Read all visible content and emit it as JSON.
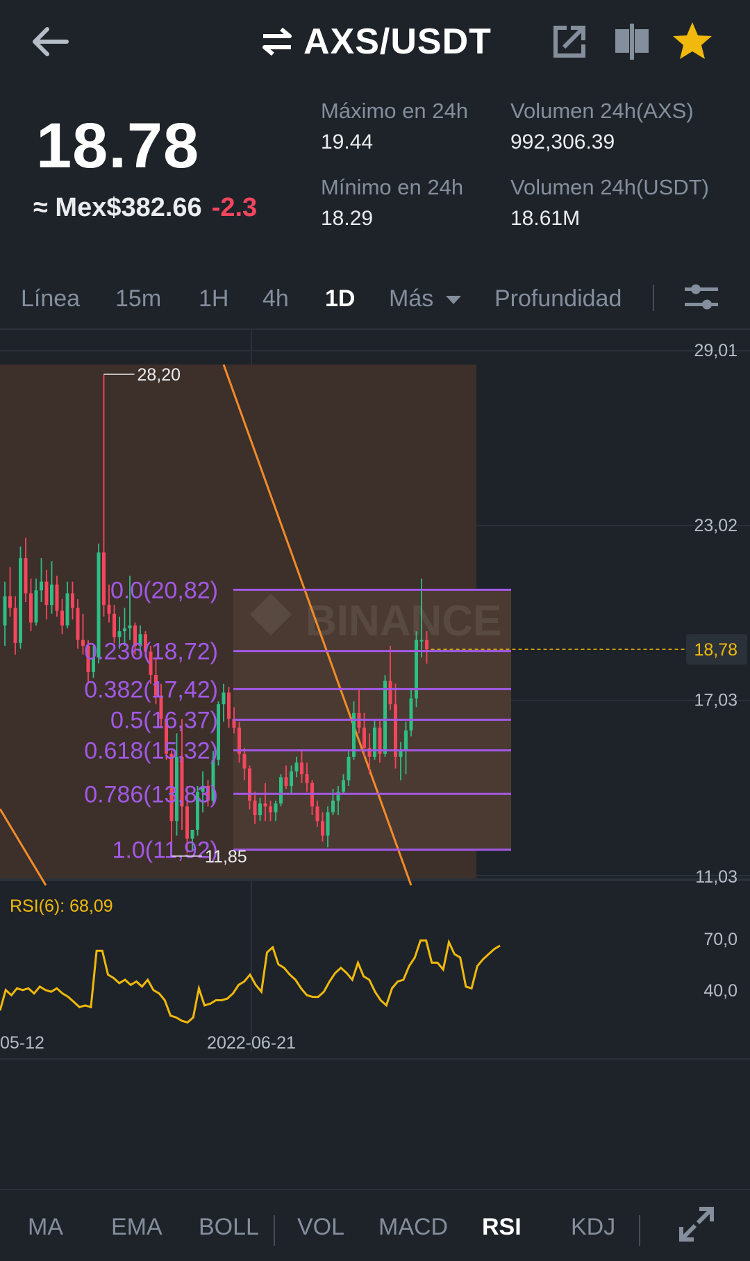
{
  "header": {
    "title": "AXS/USDT",
    "back_icon": "arrow-left-icon",
    "swap_icon": "swap-arrows-icon",
    "share_icon": "share-external-icon",
    "compare_icon": "candlestick-compare-icon",
    "favorite_icon": "star-icon",
    "favorite_color": "#f0b90b"
  },
  "ticker": {
    "last_price": "18.78",
    "fiat_price": "≈ Mex$382.66",
    "change": "-2.3",
    "high_label": "Máximo en 24h",
    "high_value": "19.44",
    "low_label": "Mínimo en 24h",
    "low_value": "18.29",
    "vol_base_label": "Volumen 24h(AXS)",
    "vol_base_value": "992,306.39",
    "vol_quote_label": "Volumen 24h(USDT)",
    "vol_quote_value": "18.61M"
  },
  "timeframes": [
    "Línea",
    "15m",
    "1H",
    "4h",
    "1D",
    "Más",
    "Profundidad"
  ],
  "active_timeframe": "1D",
  "indicators": [
    "MA",
    "EMA",
    "BOLL",
    "VOL",
    "MACD",
    "RSI",
    "KDJ"
  ],
  "active_indicator": "RSI",
  "colors": {
    "up": "#2ebd85",
    "down": "#f6465d",
    "fib": "#a259e6",
    "trend": "#f28c28",
    "rsi": "#f0b90b",
    "current_price": "#f0b90b"
  },
  "chart_data": {
    "type": "candlestick",
    "price_axis_ticks": [
      "29,01",
      "23,02",
      "17,03",
      "11,03"
    ],
    "price_range": [
      11.03,
      29.01
    ],
    "current_price_label": "18,78",
    "high_marker": "28,20",
    "low_marker": "11,85",
    "watermark": "BINANCE",
    "fibonacci": [
      {
        "level": "0.0",
        "price": 20.82,
        "label": "0.0(20,82)"
      },
      {
        "level": "0.236",
        "price": 18.72,
        "label": "0.236(18,72)"
      },
      {
        "level": "0.382",
        "price": 17.42,
        "label": "0.382(17,42)"
      },
      {
        "level": "0.5",
        "price": 16.37,
        "label": "0.5(16,37)"
      },
      {
        "level": "0.618",
        "price": 15.32,
        "label": "0.618(15,32)"
      },
      {
        "level": "0.786",
        "price": 13.83,
        "label": "0.786(13,83)"
      },
      {
        "level": "1.0",
        "price": 11.92,
        "label": "1.0(11,92)"
      }
    ],
    "candles": [
      [
        19.6,
        21.1,
        18.9,
        20.6
      ],
      [
        20.6,
        21.6,
        19.9,
        20.2
      ],
      [
        20.2,
        20.6,
        18.6,
        19.0
      ],
      [
        19.0,
        22.3,
        18.8,
        21.9
      ],
      [
        21.9,
        22.6,
        20.4,
        20.7
      ],
      [
        20.7,
        21.2,
        19.4,
        19.7
      ],
      [
        19.7,
        21.2,
        19.6,
        20.8
      ],
      [
        20.8,
        21.9,
        20.4,
        21.1
      ],
      [
        21.1,
        21.5,
        19.8,
        20.3
      ],
      [
        20.3,
        21.8,
        20.0,
        21.0
      ],
      [
        21.0,
        21.3,
        19.9,
        20.1
      ],
      [
        20.1,
        20.5,
        19.3,
        19.6
      ],
      [
        19.6,
        21.1,
        19.5,
        20.7
      ],
      [
        20.7,
        21.1,
        19.8,
        20.2
      ],
      [
        20.2,
        20.5,
        18.8,
        19.1
      ],
      [
        19.1,
        20.0,
        18.6,
        18.9
      ],
      [
        18.9,
        19.1,
        17.6,
        18.0
      ],
      [
        18.0,
        18.9,
        17.8,
        18.5
      ],
      [
        18.5,
        22.4,
        18.3,
        22.1
      ],
      [
        22.1,
        28.2,
        19.9,
        20.3
      ],
      [
        20.3,
        21.0,
        19.7,
        20.0
      ],
      [
        20.0,
        20.3,
        19.0,
        19.2
      ],
      [
        19.2,
        19.9,
        18.8,
        19.4
      ],
      [
        19.4,
        20.2,
        18.9,
        19.5
      ],
      [
        19.5,
        21.3,
        19.1,
        19.6
      ],
      [
        19.6,
        19.7,
        18.6,
        18.9
      ],
      [
        18.9,
        19.6,
        18.6,
        19.3
      ],
      [
        19.3,
        19.4,
        18.5,
        18.7
      ],
      [
        18.7,
        18.9,
        17.6,
        17.9
      ],
      [
        17.9,
        18.5,
        16.9,
        17.2
      ],
      [
        17.2,
        17.6,
        16.1,
        16.4
      ],
      [
        16.4,
        16.5,
        15.0,
        15.2
      ],
      [
        15.2,
        15.3,
        11.7,
        12.9
      ],
      [
        12.9,
        15.9,
        12.4,
        15.1
      ],
      [
        15.1,
        16.4,
        12.6,
        13.4
      ],
      [
        13.4,
        14.1,
        11.8,
        12.3
      ],
      [
        12.3,
        12.5,
        11.85,
        12.6
      ],
      [
        12.6,
        14.1,
        12.4,
        13.9
      ],
      [
        13.9,
        14.6,
        13.2,
        14.1
      ],
      [
        14.1,
        14.3,
        13.4,
        13.6
      ],
      [
        13.6,
        15.3,
        13.5,
        15.0
      ],
      [
        15.0,
        17.0,
        14.8,
        16.9
      ],
      [
        16.9,
        17.6,
        16.3,
        17.3
      ],
      [
        17.3,
        17.5,
        16.1,
        16.4
      ],
      [
        16.4,
        16.8,
        15.9,
        16.1
      ],
      [
        16.1,
        16.3,
        14.9,
        15.2
      ],
      [
        15.2,
        15.4,
        14.3,
        14.7
      ],
      [
        14.7,
        14.8,
        13.3,
        13.6
      ],
      [
        13.6,
        13.9,
        12.8,
        13.1
      ],
      [
        13.1,
        13.7,
        12.9,
        13.5
      ],
      [
        13.5,
        14.2,
        12.9,
        13.4
      ],
      [
        13.4,
        13.6,
        12.9,
        13.2
      ],
      [
        13.2,
        13.6,
        12.9,
        13.5
      ],
      [
        13.5,
        14.5,
        13.4,
        14.4
      ],
      [
        14.4,
        14.8,
        14.0,
        14.1
      ],
      [
        14.1,
        14.8,
        13.8,
        14.6
      ],
      [
        14.6,
        15.1,
        14.4,
        14.9
      ],
      [
        14.9,
        15.3,
        14.2,
        14.5
      ],
      [
        14.5,
        14.9,
        13.9,
        14.2
      ],
      [
        14.2,
        14.3,
        13.1,
        13.4
      ],
      [
        13.4,
        13.6,
        12.7,
        12.9
      ],
      [
        12.9,
        13.2,
        12.2,
        12.4
      ],
      [
        12.4,
        13.4,
        12.0,
        13.2
      ],
      [
        13.2,
        14.0,
        13.1,
        13.6
      ],
      [
        13.6,
        14.1,
        13.1,
        13.9
      ],
      [
        13.9,
        14.5,
        13.8,
        14.3
      ],
      [
        14.3,
        15.3,
        14.1,
        15.1
      ],
      [
        15.1,
        17.0,
        15.0,
        16.6
      ],
      [
        16.6,
        17.4,
        15.9,
        16.1
      ],
      [
        16.1,
        16.6,
        15.1,
        15.4
      ],
      [
        15.4,
        15.9,
        14.5,
        15.1
      ],
      [
        15.1,
        16.4,
        15.0,
        16.1
      ],
      [
        16.1,
        16.4,
        14.9,
        15.2
      ],
      [
        15.2,
        17.9,
        15.1,
        17.7
      ],
      [
        17.7,
        18.9,
        16.7,
        16.9
      ],
      [
        16.9,
        17.6,
        14.7,
        15.1
      ],
      [
        15.1,
        15.6,
        14.3,
        15.3
      ],
      [
        15.3,
        16.3,
        14.5,
        16.0
      ],
      [
        16.0,
        17.4,
        15.8,
        17.1
      ],
      [
        17.1,
        19.4,
        16.8,
        19.1
      ],
      [
        19.1,
        21.2,
        18.5,
        19.1
      ],
      [
        19.1,
        19.4,
        18.29,
        18.78
      ]
    ],
    "rsi": {
      "label": "RSI(6): 68,09",
      "period": 6,
      "value": 68.09,
      "ticks": [
        "70,0",
        "40,0"
      ],
      "range": [
        20,
        85
      ],
      "values": [
        28,
        40,
        37,
        41,
        40,
        41,
        38,
        42,
        40,
        39,
        41,
        38,
        36,
        33,
        30,
        31,
        30,
        63,
        63,
        49,
        47,
        44,
        46,
        43,
        45,
        42,
        46,
        40,
        38,
        34,
        25,
        24,
        22,
        21,
        24,
        41,
        31,
        32,
        34,
        34,
        35,
        38,
        43,
        45,
        49,
        43,
        39,
        62,
        65,
        55,
        53,
        49,
        46,
        41,
        37,
        36,
        36,
        39,
        45,
        50,
        53,
        50,
        46,
        56,
        48,
        46,
        39,
        34,
        31,
        41,
        45,
        46,
        54,
        59,
        69,
        69,
        56,
        56,
        52,
        68,
        61,
        59,
        42,
        41,
        54,
        58,
        61,
        64,
        66
      ]
    },
    "x_axis_ticks": [
      "05-12",
      "2022-06-21"
    ]
  }
}
